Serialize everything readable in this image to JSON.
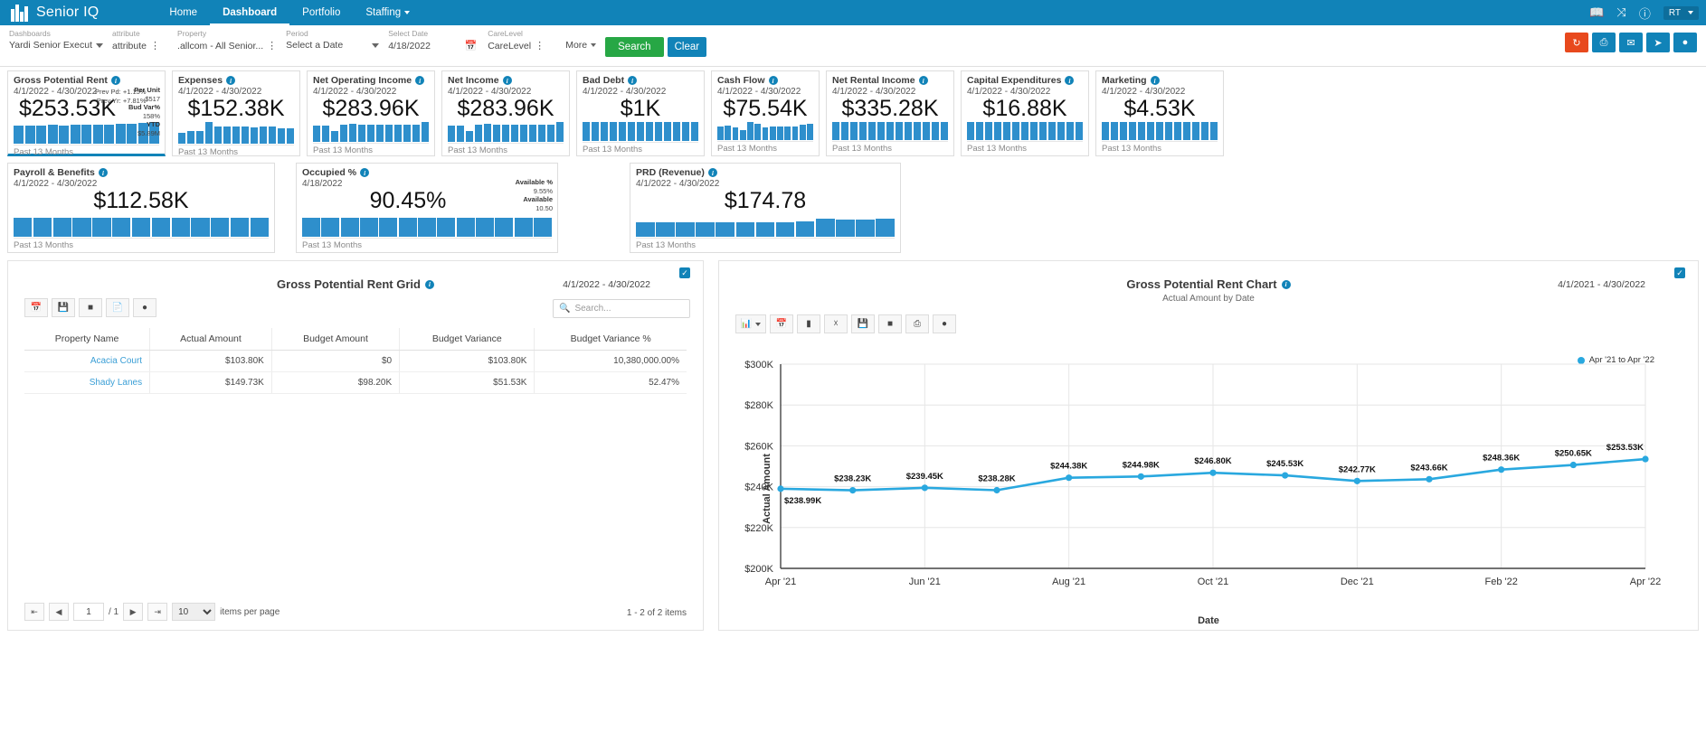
{
  "topnav": {
    "brand": "Senior IQ",
    "items": [
      {
        "label": "Home",
        "active": false
      },
      {
        "label": "Dashboard",
        "active": true
      },
      {
        "label": "Portfolio",
        "active": false
      },
      {
        "label": "Staffing",
        "active": false,
        "caret": true
      }
    ],
    "right_icons": [
      "book-icon",
      "shuffle-icon",
      "help-icon"
    ],
    "user": "RT"
  },
  "filters": [
    {
      "label": "Dashboards",
      "value": "Yardi Senior Execut",
      "control": "dropdown"
    },
    {
      "label": "attribute",
      "value": "attribute",
      "control": "dots"
    },
    {
      "label": "Property",
      "value": ".allcom - All Senior...",
      "control": "dots"
    },
    {
      "label": "Period",
      "value": "Select a Date",
      "control": "dropdown"
    },
    {
      "label": "Select Date",
      "value": "4/18/2022",
      "control": "calendar"
    },
    {
      "label": "CareLevel",
      "value": "CareLevel",
      "control": "dots"
    }
  ],
  "filter_more": "More",
  "buttons": {
    "search": "Search",
    "clear": "Clear"
  },
  "action_icons": [
    "refresh-icon",
    "print-icon",
    "email-icon",
    "share-icon",
    "comment-icon"
  ],
  "kpis_row1": [
    {
      "title": "Gross Potential Rent",
      "date": "4/1/2022 - 4/30/2022",
      "value": "$253.53K",
      "footer": "Past 13 Months",
      "selected": true,
      "prev": [
        {
          "label": "Prev Pd:",
          "value": "+1.15%"
        },
        {
          "label": "Prev Yr:",
          "value": "+7.81%"
        }
      ],
      "side": [
        {
          "label": "Per Unit",
          "value": "$517"
        },
        {
          "label": "Bud Var%",
          "value": "158%"
        },
        {
          "label": "YTD",
          "value": "$5.89M"
        }
      ],
      "spark": [
        76,
        78,
        77,
        79,
        78,
        80,
        81,
        80,
        82,
        83,
        85,
        88,
        92
      ]
    },
    {
      "title": "Expenses",
      "date": "4/1/2022 - 4/30/2022",
      "value": "$152.38K",
      "footer": "Past 13 Months",
      "selected": false,
      "spark": [
        46,
        55,
        52,
        92,
        74,
        74,
        72,
        72,
        70,
        72,
        71,
        66,
        64
      ]
    },
    {
      "title": "Net Operating Income",
      "date": "4/1/2022 - 4/30/2022",
      "value": "$283.96K",
      "footer": "Past 13 Months",
      "selected": false,
      "spark": [
        68,
        70,
        46,
        72,
        75,
        74,
        73,
        73,
        74,
        73,
        72,
        74,
        84
      ]
    },
    {
      "title": "Net Income",
      "date": "4/1/2022 - 4/30/2022",
      "value": "$283.96K",
      "footer": "Past 13 Months",
      "selected": false,
      "spark": [
        68,
        70,
        46,
        72,
        75,
        74,
        73,
        73,
        74,
        73,
        72,
        74,
        84
      ]
    },
    {
      "title": "Bad Debt",
      "date": "4/1/2022 - 4/30/2022",
      "value": "$1K",
      "footer": "Past 13 Months",
      "selected": false,
      "spark": [
        80,
        80,
        80,
        80,
        80,
        80,
        80,
        80,
        80,
        80,
        80,
        80,
        80
      ]
    },
    {
      "title": "Cash Flow",
      "date": "4/1/2022 - 4/30/2022",
      "value": "$75.54K",
      "footer": "Past 13 Months",
      "selected": false,
      "spark": [
        56,
        60,
        54,
        42,
        76,
        68,
        54,
        58,
        58,
        58,
        58,
        66,
        70
      ]
    },
    {
      "title": "Net Rental Income",
      "date": "4/1/2022 - 4/30/2022",
      "value": "$335.28K",
      "footer": "Past 13 Months",
      "selected": false,
      "spark": [
        78,
        78,
        78,
        78,
        78,
        78,
        78,
        78,
        78,
        78,
        78,
        78,
        78
      ]
    },
    {
      "title": "Capital Expenditures",
      "date": "4/1/2022 - 4/30/2022",
      "value": "$16.88K",
      "footer": "Past 13 Months",
      "selected": false,
      "spark": [
        78,
        78,
        78,
        78,
        78,
        78,
        78,
        78,
        78,
        78,
        78,
        78,
        78
      ]
    },
    {
      "title": "Marketing",
      "date": "4/1/2022 - 4/30/2022",
      "value": "$4.53K",
      "footer": "Past 13 Months",
      "selected": false,
      "spark": [
        78,
        78,
        78,
        78,
        78,
        78,
        78,
        78,
        78,
        78,
        78,
        78,
        78
      ]
    }
  ],
  "kpis_row2": [
    {
      "title": "Payroll & Benefits",
      "date": "4/1/2022 - 4/30/2022",
      "value": "$112.58K",
      "footer": "Past 13 Months",
      "selected": false,
      "spark": [
        80,
        80,
        80,
        80,
        80,
        80,
        80,
        80,
        80,
        80,
        80,
        80,
        80
      ]
    },
    {
      "title": "Occupied %",
      "date": "4/18/2022",
      "value": "90.45%",
      "footer": "Past 13 Months",
      "selected": false,
      "side": [
        {
          "label": "Available %",
          "value": "9.55%"
        },
        {
          "label": "Available",
          "value": "10.50"
        }
      ],
      "spark": [
        80,
        80,
        80,
        80,
        80,
        80,
        80,
        80,
        80,
        80,
        80,
        80,
        80
      ]
    },
    {
      "title": "PRD (Revenue)",
      "date": "4/1/2022 - 4/30/2022",
      "value": "$174.78",
      "footer": "Past 13 Months",
      "selected": false,
      "spark": [
        62,
        62,
        62,
        62,
        62,
        62,
        62,
        62,
        66,
        78,
        72,
        72,
        78
      ]
    }
  ],
  "grid_panel": {
    "title": "Gross Potential Rent Grid",
    "date_range": "4/1/2022 - 4/30/2022",
    "toolbar_icons": [
      "calendar-icon",
      "save-icon",
      "excel-icon",
      "pdf-icon",
      "comment-icon"
    ],
    "search_placeholder": "Search...",
    "columns": [
      "Property Name",
      "Actual Amount",
      "Budget Amount",
      "Budget Variance",
      "Budget Variance %"
    ],
    "rows": [
      {
        "property": "Acacia Court",
        "actual": "$103.80K",
        "budget": "$0",
        "variance": "$103.80K",
        "variance_pct": "10,380,000.00%"
      },
      {
        "property": "Shady Lanes",
        "actual": "$149.73K",
        "budget": "$98.20K",
        "variance": "$51.53K",
        "variance_pct": "52.47%"
      }
    ],
    "pager": {
      "page": "1",
      "total": "/ 1",
      "page_size": "10",
      "items_per_page": "items per page",
      "count": "1 - 2 of 2 items"
    }
  },
  "chart_panel": {
    "title": "Gross Potential Rent Chart",
    "subtitle": "Actual Amount by Date",
    "date_range": "4/1/2021 - 4/30/2022",
    "toolbar_icons": [
      "chart-type-icon",
      "calendar-icon",
      "column-icon",
      "no-label-icon",
      "save-icon",
      "excel-icon",
      "print-icon",
      "comment-icon"
    ]
  },
  "chart_data": {
    "type": "line",
    "title": "Gross Potential Rent Chart",
    "subtitle": "Actual Amount by Date",
    "xlabel": "Date",
    "ylabel": "Actual Amount",
    "ylim": [
      200000,
      300000
    ],
    "yticks": [
      200000,
      220000,
      240000,
      260000,
      280000,
      300000
    ],
    "ytick_labels": [
      "$200K",
      "$220K",
      "$240K",
      "$260K",
      "$280K",
      "$300K"
    ],
    "xtick_labels": [
      "Apr '21",
      "Jun '21",
      "Aug '21",
      "Oct '21",
      "Dec '21",
      "Feb '22",
      "Apr '22"
    ],
    "legend": [
      "Apr '21 to Apr '22"
    ],
    "legend_position": "top-right",
    "grid": true,
    "series": [
      {
        "name": "Apr '21 to Apr '22",
        "color": "#29a8df",
        "x": [
          "Apr '21",
          "May '21",
          "Jun '21",
          "Jul '21",
          "Aug '21",
          "Sep '21",
          "Oct '21",
          "Nov '21",
          "Dec '21",
          "Jan '22",
          "Feb '22",
          "Mar '22",
          "Apr '22"
        ],
        "values": [
          238990,
          238230,
          239450,
          238280,
          244380,
          244980,
          246800,
          245530,
          242770,
          243660,
          248360,
          250650,
          253530
        ],
        "labels": [
          "$238.99K",
          "$238.23K",
          "$239.45K",
          "$238.28K",
          "$244.38K",
          "$244.98K",
          "$246.80K",
          "$245.53K",
          "$242.77K",
          "$243.66K",
          "$248.36K",
          "$250.65K",
          "$253.53K"
        ]
      }
    ]
  },
  "colors": {
    "brand": "#1183b8",
    "accent": "#29a8df",
    "search": "#27a745",
    "alert": "#e8491d",
    "bar": "#2e8fcc"
  }
}
